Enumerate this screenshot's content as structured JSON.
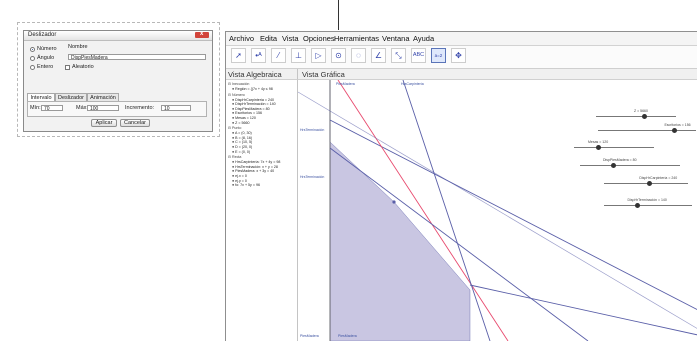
{
  "dialog": {
    "title": "Deslizador",
    "radio_number": "Número",
    "radio_angle": "Ángulo",
    "radio_integer": "Entero",
    "name_label": "Nombre",
    "name_value": "DispPiesMadera",
    "random_label": "Aleatorio",
    "tabs": [
      "Intervalo",
      "Deslizador",
      "Animación"
    ],
    "min_label": "Mín:",
    "min_value": "70",
    "max_label": "Máx:",
    "max_value": "100",
    "increment_label": "Incremento:",
    "increment_value": "10",
    "apply_button": "Aplicar",
    "cancel_button": "Cancelar"
  },
  "menubar": [
    "Archivo",
    "Edita",
    "Vista",
    "Opciones",
    "Herramientas",
    "Ventana",
    "Ayuda"
  ],
  "toolbar": {
    "tools": [
      "pointer-tool",
      "point-tool",
      "line-tool",
      "perpendicular-tool",
      "polygon-tool",
      "circle-tool",
      "conic-tool",
      "angle-tool",
      "reflect-tool",
      "text-tool",
      "slider-tool",
      "move-view-tool"
    ],
    "text_tool_label": "ABC",
    "slider_tool_label": "a=2"
  },
  "algebra_view": {
    "title": "Vista Algebraica",
    "sections": [
      {
        "name": "Inecuación",
        "items": [
          "Región = {(7x + 4y ≤ 98"
        ]
      },
      {
        "name": "Número",
        "items": [
          "DispHrCarpintería = 240",
          "DispHrTerminación = 140",
          "DispPiesMadera = 80",
          "Escritorios = 156",
          "Mesas = 120",
          "Z = 5660"
        ]
      },
      {
        "name": "Punto",
        "items": [
          "A = (0, 30)",
          "B = (8, 16)",
          "C = (10, 5)",
          "D = (20, 0)",
          "E = (0, 0)"
        ]
      },
      {
        "name": "Recta",
        "items": [
          "HrsCarpintería: 7x + 4y = 98",
          "HrsTerminación: x + y = 28",
          "PiesMadera: x + 3y = 40",
          "ej.x = 0",
          "ej.y = 0",
          "fo: 7x + 5y = 96"
        ]
      }
    ]
  },
  "graphics_view": {
    "title": "Vista Gráfica",
    "line_labels": [
      "PiesMadera",
      "HrsCarpintería",
      "HrsTerminación",
      "HrsTerminación",
      "PiesMadera",
      "PiesMadera"
    ],
    "sliders": [
      {
        "label": "Z = 5660",
        "fraction": 0.6
      },
      {
        "label": "Escritorios = 156",
        "fraction": 0.78
      },
      {
        "label": "Mesas = 120",
        "fraction": 0.3
      },
      {
        "label": "DispPiesMadera = 80",
        "fraction": 0.33
      },
      {
        "label": "DispHrCarpintería = 240",
        "fraction": 0.54
      },
      {
        "label": "DispHrTerminación = 140",
        "fraction": 0.38
      }
    ]
  },
  "colors": {
    "feasible_region": "#c9c6e2",
    "line_blue": "#5a5fa8",
    "line_red": "#e84a6e",
    "dialog_close": "#d2443a",
    "toolbar_selected": "#dfe8fb"
  }
}
